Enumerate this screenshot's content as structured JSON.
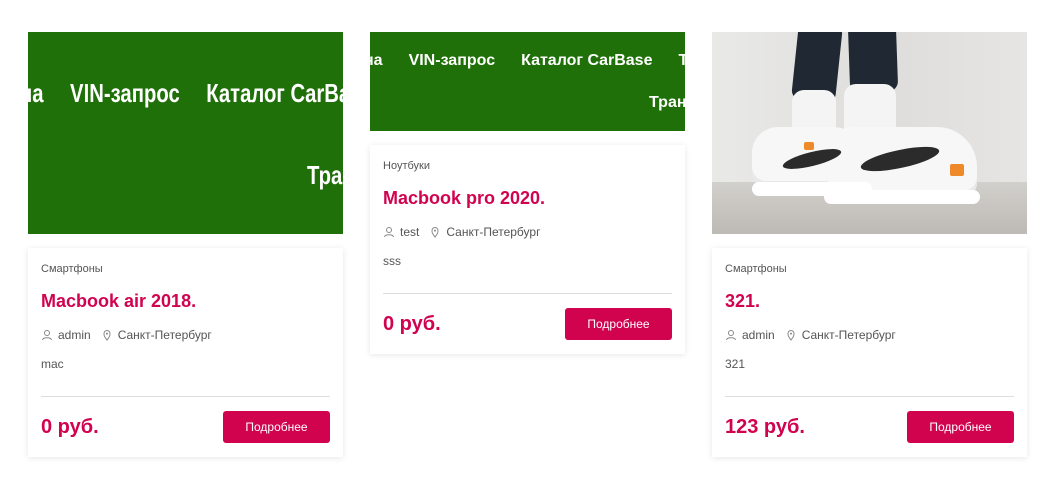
{
  "banner": {
    "row1": [
      "на",
      "VIN-запрос",
      "Каталог CarBase",
      "Т"
    ],
    "row2": "Тран",
    "background": "#1f7008"
  },
  "accent_color": "#d1034f",
  "cards": [
    {
      "category": "Смартфоны",
      "title": "Macbook air 2018.",
      "author": "admin",
      "city": "Санкт-Петербург",
      "description": "mac",
      "price": "0 руб.",
      "button_label": "Подробнее",
      "image": "banner"
    },
    {
      "category": "Ноутбуки",
      "title": "Macbook pro 2020.",
      "author": "test",
      "city": "Санкт-Петербург",
      "description": "sss",
      "price": "0 руб.",
      "button_label": "Подробнее",
      "image": "banner"
    },
    {
      "category": "Смартфоны",
      "title": "321.",
      "author": "admin",
      "city": "Санкт-Петербург",
      "description": "321",
      "price": "123 руб.",
      "button_label": "Подробнее",
      "image": "sneakers-photo"
    }
  ]
}
